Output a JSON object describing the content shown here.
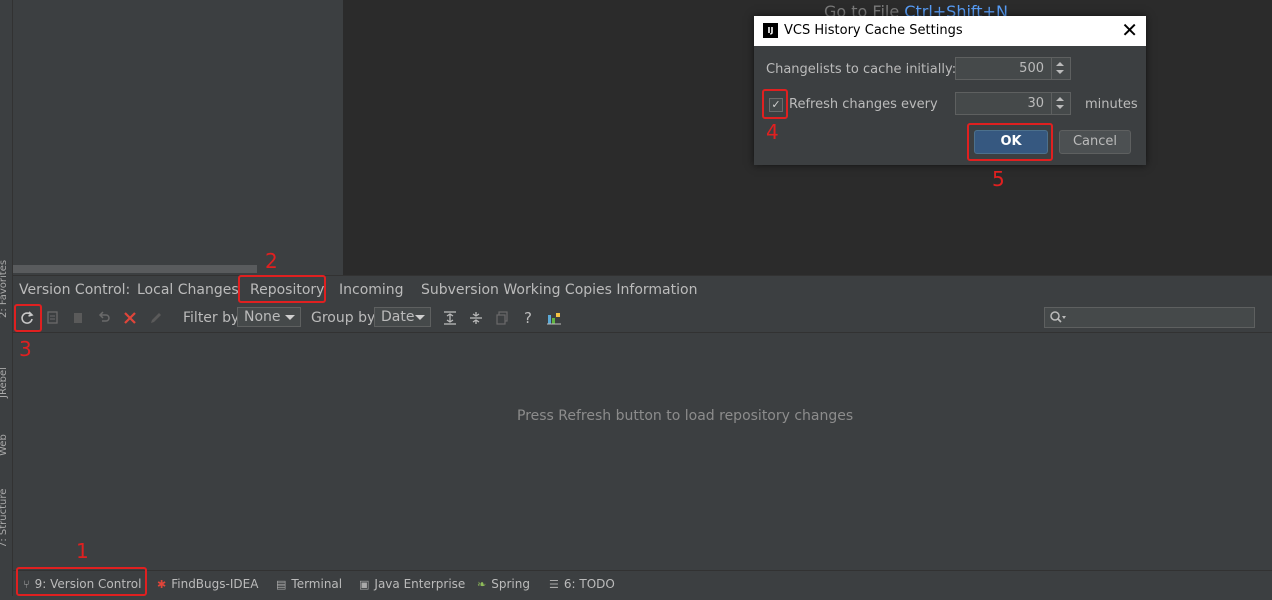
{
  "editor": {
    "hint_text": "Go to File",
    "hint_shortcut": "Ctrl+Shift+N"
  },
  "left_stripe": {
    "tabs": [
      "2: Favorites",
      "JRebel",
      "Web",
      "7: Structure"
    ]
  },
  "vc_panel": {
    "title": "Version Control:",
    "tabs": [
      "Local Changes",
      "Repository",
      "Incoming",
      "Subversion Working Copies Information"
    ],
    "active_tab": "Repository",
    "toolbar": {
      "filter_label": "Filter by",
      "filter_value": "None",
      "group_label": "Group by",
      "group_value": "Date",
      "help": "?",
      "icons": [
        "refresh-icon",
        "copy-icon",
        "paste-icon",
        "undo-icon",
        "delete-icon",
        "edit-icon",
        "expand-all-icon",
        "collapse-all-icon",
        "copy2-icon",
        "help-icon",
        "graph-icon"
      ]
    },
    "empty_message": "Press Refresh button to load repository changes"
  },
  "bottom_tabs": [
    {
      "label": "9: Version Control",
      "icon": "vcs-icon"
    },
    {
      "label": "FindBugs-IDEA",
      "icon": "bug-icon"
    },
    {
      "label": "Terminal",
      "icon": "terminal-icon"
    },
    {
      "label": "Java Enterprise",
      "icon": "java-ee-icon"
    },
    {
      "label": "Spring",
      "icon": "spring-icon"
    },
    {
      "label": "6: TODO",
      "icon": "todo-icon"
    }
  ],
  "dialog": {
    "title": "VCS History Cache Settings",
    "logo": "IJ",
    "changelists_label": "Changelists to cache initially:",
    "changelists_value": "500",
    "refresh_label": "Refresh changes every",
    "refresh_value": "30",
    "refresh_unit": "minutes",
    "refresh_checked": true,
    "ok_label": "OK",
    "cancel_label": "Cancel"
  },
  "annotations": [
    "1",
    "2",
    "3",
    "4",
    "5"
  ],
  "colors": {
    "accent": "#365880",
    "annotation": "#e02020",
    "link": "#589df6"
  }
}
